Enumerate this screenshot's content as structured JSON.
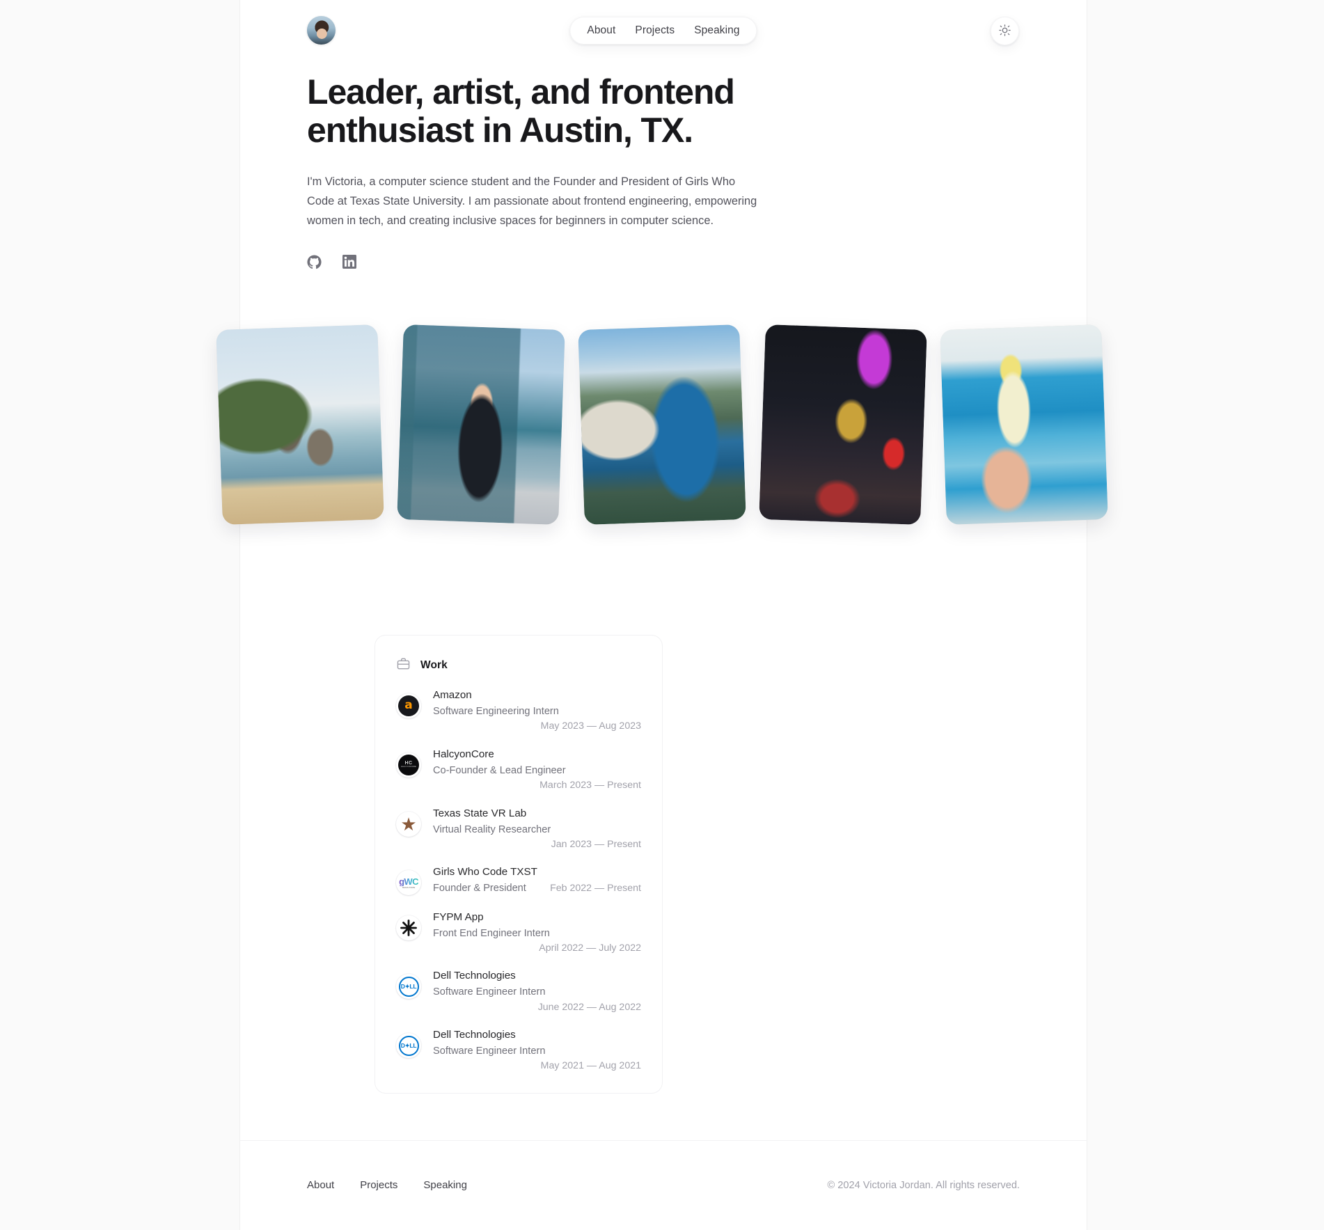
{
  "header": {
    "avatar_alt": "Victoria Jordan portrait",
    "nav": [
      {
        "label": "About"
      },
      {
        "label": "Projects"
      },
      {
        "label": "Speaking"
      }
    ],
    "theme_toggle_icon": "sun-icon",
    "theme_toggle_label": "Switch to dark theme"
  },
  "hero": {
    "title": "Leader, artist, and frontend enthusiast in Austin, TX.",
    "body": "I'm Victoria, a computer science student and the Founder and President of Girls Who Code at Texas State University. I am passionate about frontend engineering, empowering women in tech, and creating inclusive spaces for beginners in computer science.",
    "socials": [
      {
        "name": "github-icon",
        "label": "GitHub"
      },
      {
        "name": "linkedin-icon",
        "label": "LinkedIn"
      }
    ]
  },
  "gallery": [
    {
      "caption": "Beach with limestone cliffs",
      "rotation": "-2deg"
    },
    {
      "caption": "Standing in front of the Shanghai skyline",
      "rotation": "2deg"
    },
    {
      "caption": "Sitting on Trolltunga cliff above a fjord",
      "rotation": "-2deg"
    },
    {
      "caption": "Neon-lit Hong Kong street at night",
      "rotation": "2deg"
    },
    {
      "caption": "Cockatiel perched on a hand",
      "rotation": "-2deg"
    }
  ],
  "work": {
    "icon": "briefcase-icon",
    "title": "Work",
    "jobs": [
      {
        "company": "Amazon",
        "role": "Software Engineering Intern",
        "date": "May 2023 — Aug 2023",
        "logo": "amazon-logo"
      },
      {
        "company": "HalcyonCore",
        "role": "Co-Founder & Lead Engineer",
        "date": "March 2023 — Present",
        "logo": "halcyoncore-logo"
      },
      {
        "company": "Texas State VR Lab",
        "role": "Virtual Reality Researcher",
        "date": "Jan 2023 — Present",
        "logo": "texas-state-star-logo"
      },
      {
        "company": "Girls Who Code TXST",
        "role": "Founder & President",
        "date": "Feb 2022 — Present",
        "logo": "girls-who-code-logo"
      },
      {
        "company": "FYPM App",
        "role": "Front End Engineer Intern",
        "date": "April 2022 — July 2022",
        "logo": "fypm-logo"
      },
      {
        "company": "Dell Technologies",
        "role": "Software Engineer Intern",
        "date": "June 2022 — Aug 2022",
        "logo": "dell-logo"
      },
      {
        "company": "Dell Technologies",
        "role": "Software Engineer Intern",
        "date": "May 2021 — Aug 2021",
        "logo": "dell-logo"
      }
    ]
  },
  "footer": {
    "nav": [
      {
        "label": "About"
      },
      {
        "label": "Projects"
      },
      {
        "label": "Speaking"
      }
    ],
    "copyright": "© 2024 Victoria Jordan. All rights reserved."
  },
  "theme": {
    "page_background": "#fafafa",
    "content_background": "#ffffff",
    "text_primary": "#18181b",
    "text_secondary": "#52525b",
    "text_muted": "#a1a1aa"
  }
}
